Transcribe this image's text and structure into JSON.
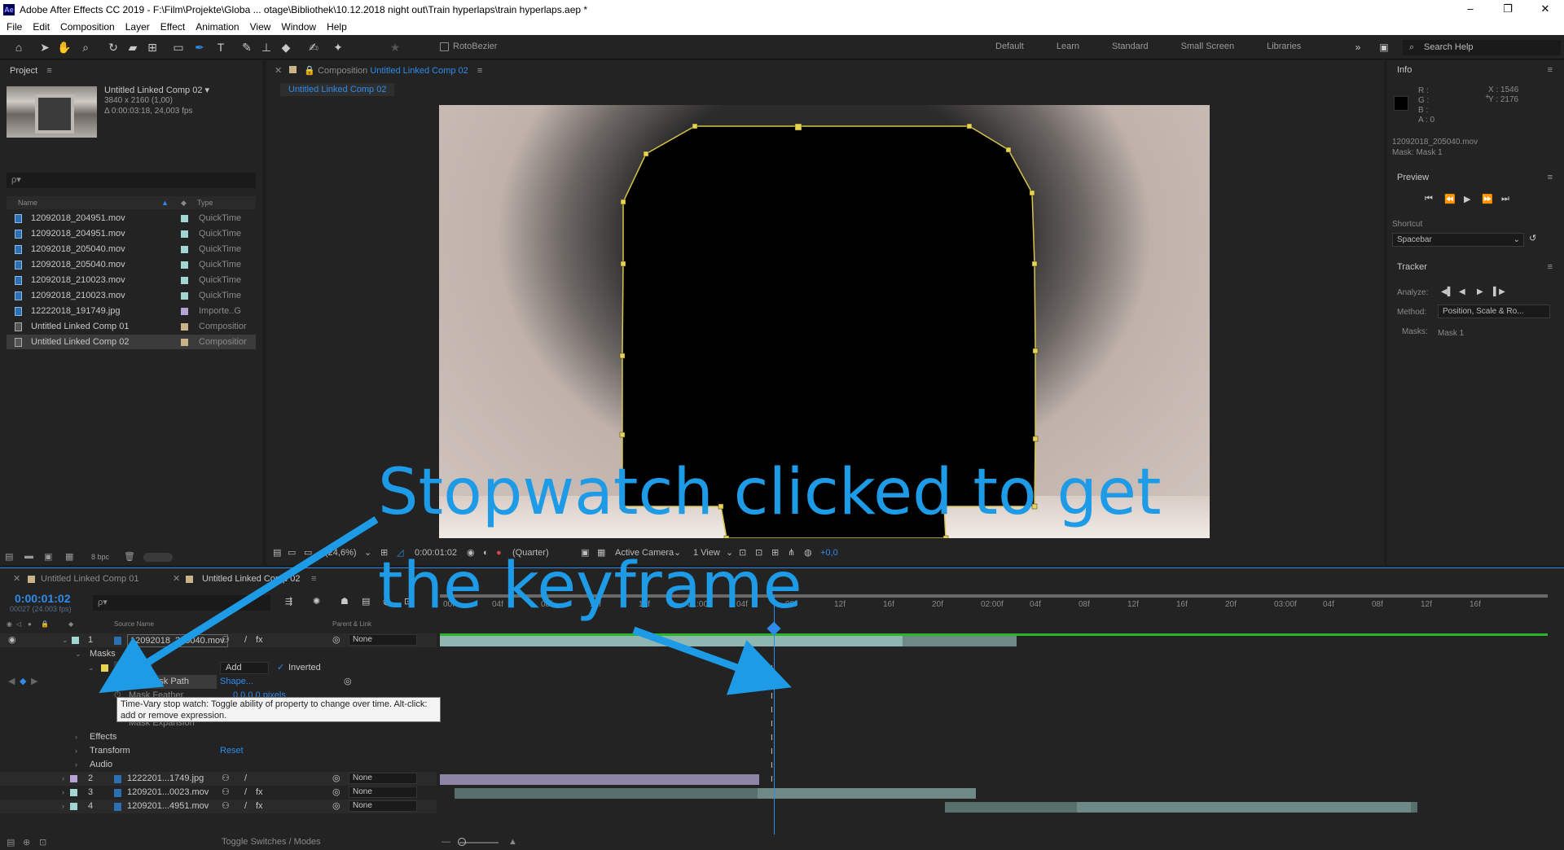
{
  "window": {
    "title": "Adobe After Effects CC 2019 - F:\\Film\\Projekte\\Globa ... otage\\Bibliothek\\10.12.2018 night out\\Train hyperlaps\\train hyperlaps.aep *",
    "app_icon": "Ae",
    "controls": [
      "–",
      "❐",
      "✕"
    ]
  },
  "menu": [
    "File",
    "Edit",
    "Composition",
    "Layer",
    "Effect",
    "Animation",
    "View",
    "Window",
    "Help"
  ],
  "toolbar": {
    "rotobezier_label": "RotoBezier",
    "workspaces": [
      "Default",
      "Learn",
      "Standard",
      "Small Screen",
      "Libraries"
    ],
    "search_placeholder": "Search Help"
  },
  "project": {
    "panel_title": "Project",
    "selected_name": "Untitled Linked Comp 02 ▾",
    "selected_dims": "3840 x 2160 (1,00)",
    "selected_duration": "Δ 0:00:03:18, 24,003 fps",
    "search_placeholder": "ρ▾",
    "col_name": "Name",
    "col_type": "Type",
    "bpc": "8 bpc",
    "items": [
      {
        "name": "12092018_204951.mov",
        "type": "QuickTime",
        "color": "#a2d6d2"
      },
      {
        "name": "12092018_204951.mov",
        "type": "QuickTime",
        "color": "#a2d6d2"
      },
      {
        "name": "12092018_205040.mov",
        "type": "QuickTime",
        "color": "#a2d6d2"
      },
      {
        "name": "12092018_205040.mov",
        "type": "QuickTime",
        "color": "#a2d6d2"
      },
      {
        "name": "12092018_210023.mov",
        "type": "QuickTime",
        "color": "#a2d6d2"
      },
      {
        "name": "12092018_210023.mov",
        "type": "QuickTime",
        "color": "#a2d6d2"
      },
      {
        "name": "12222018_191749.jpg",
        "type": "Importe..G",
        "color": "#b4a3d4"
      },
      {
        "name": "Untitled Linked Comp 01",
        "type": "Compositior",
        "color": "#c9b48a"
      },
      {
        "name": "Untitled Linked Comp 02",
        "type": "Compositior",
        "color": "#c9b48a"
      }
    ]
  },
  "composition": {
    "tab_prefix": "Composition",
    "tab_name": "Untitled Linked Comp 02",
    "subtab": "Untitled Linked Comp 02",
    "zoom": "(24,6%)",
    "timecode": "0:00:01:02",
    "resolution": "(Quarter)",
    "camera": "Active Camera",
    "views": "1 View",
    "exposure": "+0,0"
  },
  "info": {
    "title": "Info",
    "r": "R :",
    "g": "G :",
    "b": "B :",
    "a": "A : 0",
    "x": "X : 1546",
    "y": "Y : 2176",
    "file": "12092018_205040.mov",
    "mask": "Mask: Mask 1"
  },
  "preview": {
    "title": "Preview",
    "shortcut_label": "Shortcut",
    "shortcut_value": "Spacebar"
  },
  "tracker": {
    "title": "Tracker",
    "analyze_label": "Analyze:",
    "method_label": "Method:",
    "method_value": "Position, Scale & Ro...",
    "masks_label": "Masks:",
    "masks_value": "Mask 1"
  },
  "timeline": {
    "tabs": [
      "Untitled Linked Comp 01",
      "Untitled Linked Comp 02"
    ],
    "timecode": "0:00:01:02",
    "fps": "00027 (24.003 fps)",
    "search_placeholder": "ρ▾",
    "col_source": "Source Name",
    "col_parent": "Parent & Link",
    "ruler_ticks": [
      "00f",
      "04f",
      "08f",
      "12f",
      "16f",
      "01:00f",
      "04f",
      "08f",
      "12f",
      "16f",
      "20f",
      "02:00f",
      "04f",
      "08f",
      "12f",
      "16f",
      "20f",
      "03:00f",
      "04f",
      "08f",
      "12f",
      "16f"
    ],
    "layers": [
      {
        "num": "1",
        "name": "12092018_205040.mov",
        "parent": "None",
        "color": "#a2d6d2"
      },
      {
        "num": "2",
        "name": "1222201...1749.jpg",
        "parent": "None",
        "color": "#b4a3d4"
      },
      {
        "num": "3",
        "name": "1209201...0023.mov",
        "parent": "None",
        "color": "#a2d6d2"
      },
      {
        "num": "4",
        "name": "1209201...4951.mov",
        "parent": "None",
        "color": "#a2d6d2"
      }
    ],
    "masks_label": "Masks",
    "mask_name": "Mask 1",
    "mask_mode": "Add",
    "inverted_label": "Inverted",
    "mask_path_label": "Mask Path",
    "mask_path_value": "Shape...",
    "mask_feather_label": "Mask Feather",
    "mask_feather_value": "0,0,0,0 pixels",
    "mask_expansion_label": "Mask Expansion",
    "effects_label": "Effects",
    "transform_label": "Transform",
    "transform_reset": "Reset",
    "audio_label": "Audio",
    "tooltip": "Time-Vary stop watch: Toggle ability of property to change over time. Alt-click: add or remove expression.",
    "footer": "Toggle Switches / Modes"
  },
  "annotation": {
    "line1": "Stopwatch clicked to get",
    "line2": "the keyframe",
    "color": "#1e9be6"
  }
}
